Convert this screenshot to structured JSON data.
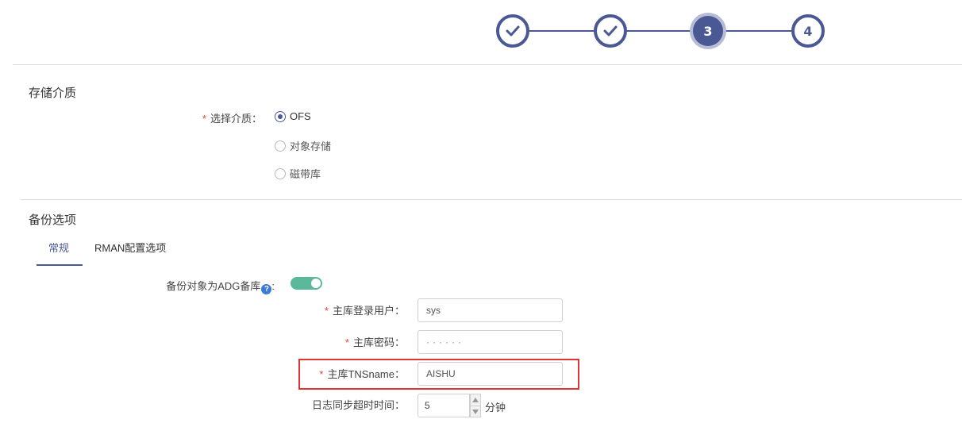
{
  "stepper": {
    "steps": [
      {
        "state": "done",
        "label": ""
      },
      {
        "state": "done",
        "label": ""
      },
      {
        "state": "current",
        "label": "3"
      },
      {
        "state": "todo",
        "label": "4"
      }
    ],
    "accent_color": "#4a5894"
  },
  "storage": {
    "section_title": "存储介质",
    "medium_label": "选择介质：",
    "options": [
      {
        "label": "OFS",
        "checked": true
      },
      {
        "label": "对象存储",
        "checked": false
      },
      {
        "label": "磁带库",
        "checked": false
      }
    ]
  },
  "backup": {
    "section_title": "备份选项",
    "tabs": [
      {
        "label": "常规",
        "active": true
      },
      {
        "label": "RMAN配置选项",
        "active": false
      }
    ],
    "adg_label": "备份对象为ADG备库",
    "adg_label_suffix": ":",
    "adg_help_icon": "?",
    "adg_enabled": true,
    "primary_user_label": "主库登录用户：",
    "primary_user_value": "sys",
    "primary_password_label": "主库密码：",
    "primary_password_value": "······",
    "primary_tns_label": "主库TNSname：",
    "primary_tns_value": "AISHU",
    "sync_timeout_label": "日志同步超时时间：",
    "sync_timeout_value": "5",
    "sync_timeout_unit": "分钟",
    "toggle_color": "#5bb89a",
    "highlight_color": "#e03434"
  }
}
